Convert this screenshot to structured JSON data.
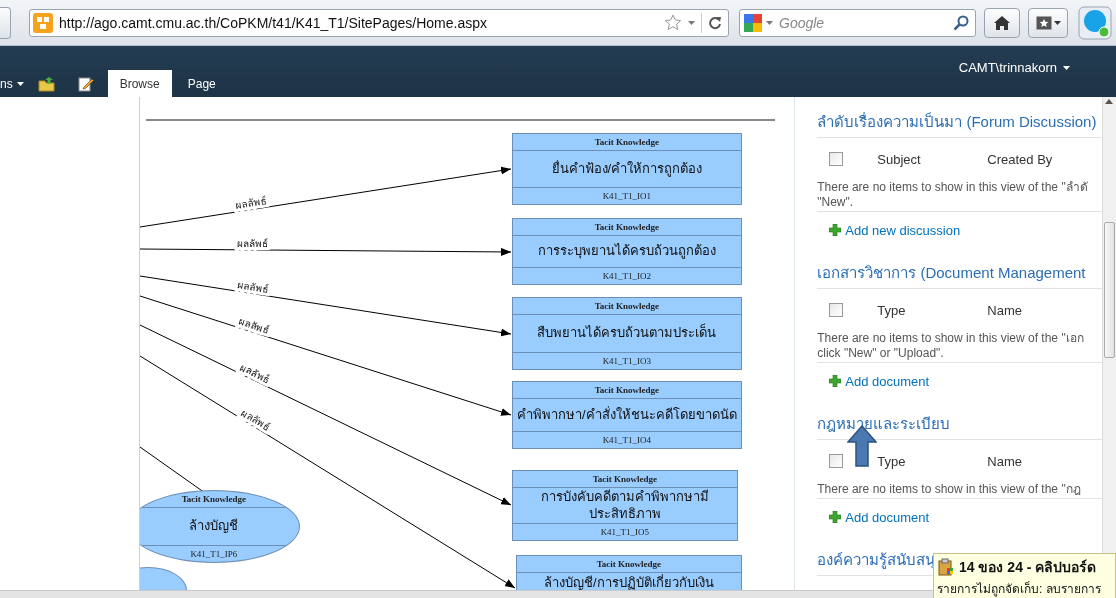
{
  "browser": {
    "url": "http://ago.camt.cmu.ac.th/CoPKM/t41/K41_T1/SitePages/Home.aspx",
    "search_placeholder": "Google"
  },
  "ribbon": {
    "menu_fragment": "ns",
    "tabs": [
      {
        "label": "Browse",
        "selected": true
      },
      {
        "label": "Page",
        "selected": false
      }
    ],
    "user": "CAMT\\trinnakorn"
  },
  "diagram": {
    "nodes": [
      {
        "kind": "box",
        "header": "Tacit Knowledge",
        "title": "ยื่นคำฟ้อง/คำให้การถูกต้อง",
        "code": "K41_T1_IO1"
      },
      {
        "kind": "box",
        "header": "Tacit Knowledge",
        "title": "การระบุพยานได้ครบถ้วนถูกต้อง",
        "code": "K41_T1_IO2"
      },
      {
        "kind": "box",
        "header": "Tacit Knowledge",
        "title": "สืบพยานได้ครบถ้วนตามประเด็น",
        "code": "K41_T1_IO3"
      },
      {
        "kind": "box",
        "header": "Tacit Knowledge",
        "title": "คำพิพากษา/คำสั่งให้ชนะคดีโดยขาดนัด",
        "code": "K41_T1_IO4"
      },
      {
        "kind": "box",
        "header": "Tacit Knowledge",
        "title": "การบังคับคดีตามคำพิพากษามีประสิทธิภาพ",
        "code": "K41_T1_IO5"
      },
      {
        "kind": "box",
        "header": "Tacit Knowledge",
        "title": "ล้างบัญชี/การปฏิบัติเกี่ยวกับเงิน"
      },
      {
        "kind": "ellipse",
        "header": "Tacit Knowledge",
        "title": "ล้างบัญชี",
        "code": "K41_T1_IP6"
      }
    ],
    "edges": [
      {
        "label": "ผลลัพธ์"
      },
      {
        "label": "ผลลัพธ์"
      },
      {
        "label": "ผลลัพธ์"
      },
      {
        "label": "ผลลัพธ์"
      },
      {
        "label": "ผลลัพธ์"
      },
      {
        "label": "ผลลัพธ์"
      }
    ]
  },
  "web_parts": [
    {
      "title": "ลำดับเรื่องความเป็นมา (Forum Discussion)",
      "columns": [
        "Subject",
        "Created By"
      ],
      "empty_message_lines": [
        "There are no items to show in this view of the \"ลำดั",
        "\"New\"."
      ],
      "add_link": "Add new discussion",
      "all_selected": false,
      "pointer_arrow": false
    },
    {
      "title": "เอกสารวิชาการ (Document Management",
      "columns": [
        "Type",
        "Name"
      ],
      "empty_message_lines": [
        "There are no items to show in this view of the \"เอก",
        "click \"New\" or \"Upload\"."
      ],
      "add_link": "Add document",
      "all_selected": false,
      "pointer_arrow": false
    },
    {
      "title": "กฎหมายและระเบียบ",
      "columns": [
        "Type",
        "Name"
      ],
      "empty_message_lines": [
        "There are no items to show in this view of the \"กฎ"
      ],
      "add_link": "Add document",
      "all_selected": false,
      "pointer_arrow": true
    },
    {
      "title": "องค์ความรู้สนับสนุ",
      "pointer_arrow": false
    }
  ],
  "tooltip": {
    "title": "14 ของ 24 - คลิปบอร์ด",
    "text": "รายการไม่ถูกจัดเก็บ: ลบรายการ"
  }
}
